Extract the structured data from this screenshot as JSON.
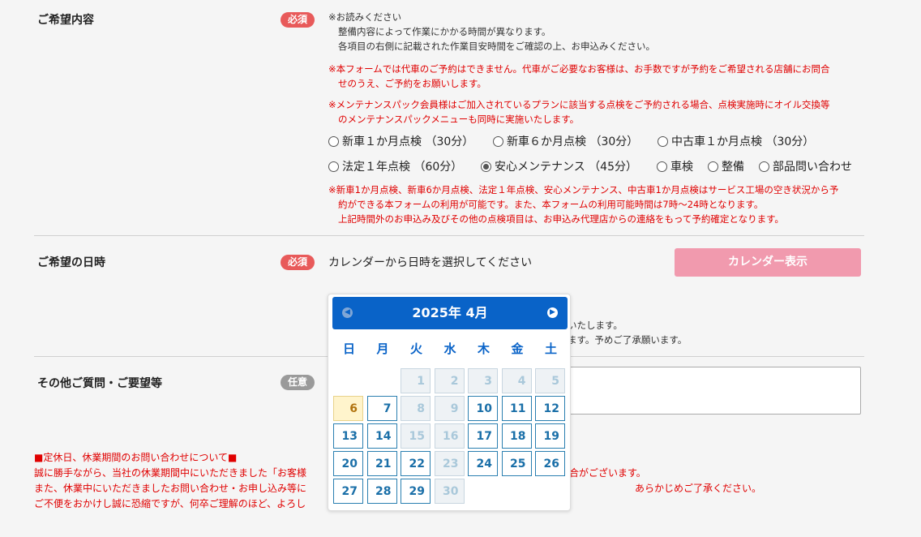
{
  "section1": {
    "label": "ご希望内容",
    "badge": "必須",
    "note_head": "※お読みください",
    "note_l1": "整備内容によって作業にかかる時間が異なります。",
    "note_l2": "各項目の右側に記載された作業目安時間をご確認の上、お申込みください。",
    "red1_l1": "※本フォームでは代車のご予約はできません。代車がご必要なお客様は、お手数ですが予約をご希望される店舗にお問合",
    "red1_l2": "せのうえ、ご予約をお願いします。",
    "red2_l1": "※メンテナンスパック会員様はご加入されているプランに該当する点検をご予約される場合、点検実施時にオイル交換等",
    "red2_l2": "のメンテナンスパックメニューも同時に実施いたします。",
    "options": [
      "新車１か月点検 （30分）",
      "新車６か月点検 （30分）",
      "中古車１か月点検 （30分）",
      "法定１年点検 （60分）",
      "安心メンテナンス （45分）",
      "車検",
      "整備",
      "部品問い合わせ"
    ],
    "red3_l1": "※新車1か月点検、新車6か月点検、法定１年点検、安心メンテナンス、中古車1か月点検はサービス工場の空き状況から予",
    "red3_l2": "約ができる本フォームの利用が可能です。また、本フォームの利用可能時間は7時〜24時となります。",
    "red3_l3": "上記時間外のお申込み及びその他の点検項目は、お申込み代理店からの連絡をもって予約確定となります。"
  },
  "section2": {
    "label": "ご希望の日時",
    "badge": "必須",
    "prompt": "カレンダーから日時を選択してください",
    "button": "カレンダー表示",
    "hidden_l1": "いたします。",
    "hidden_l2": "ます。予めご了承願います。"
  },
  "section3": {
    "label": "その他ご質問・ご要望等",
    "badge": "任意"
  },
  "calendar": {
    "title": "2025年 4月",
    "weekdays": [
      "日",
      "月",
      "火",
      "水",
      "木",
      "金",
      "土"
    ],
    "days": [
      {
        "d": "1",
        "s": "off"
      },
      {
        "d": "2",
        "s": "off"
      },
      {
        "d": "3",
        "s": "off"
      },
      {
        "d": "4",
        "s": "off"
      },
      {
        "d": "5",
        "s": "off"
      },
      {
        "d": "6",
        "s": "today"
      },
      {
        "d": "7",
        "s": "on"
      },
      {
        "d": "8",
        "s": "off"
      },
      {
        "d": "9",
        "s": "off"
      },
      {
        "d": "10",
        "s": "on"
      },
      {
        "d": "11",
        "s": "on"
      },
      {
        "d": "12",
        "s": "on"
      },
      {
        "d": "13",
        "s": "on"
      },
      {
        "d": "14",
        "s": "on"
      },
      {
        "d": "15",
        "s": "off"
      },
      {
        "d": "16",
        "s": "off"
      },
      {
        "d": "17",
        "s": "on"
      },
      {
        "d": "18",
        "s": "on"
      },
      {
        "d": "19",
        "s": "on"
      },
      {
        "d": "20",
        "s": "on"
      },
      {
        "d": "21",
        "s": "on"
      },
      {
        "d": "22",
        "s": "on"
      },
      {
        "d": "23",
        "s": "off"
      },
      {
        "d": "24",
        "s": "on"
      },
      {
        "d": "25",
        "s": "on"
      },
      {
        "d": "26",
        "s": "on"
      },
      {
        "d": "27",
        "s": "on"
      },
      {
        "d": "28",
        "s": "on"
      },
      {
        "d": "29",
        "s": "on"
      },
      {
        "d": "30",
        "s": "off"
      }
    ]
  },
  "footer": {
    "heading": "■定休日、休業期間のお問い合わせについて■",
    "l1_left": "誠に勝手ながら、当社の休業期間中にいただきました「お客様",
    "l1_right": "合がございます。",
    "l2_left": "また、休業中にいただきましたお問い合わせ・お申し込み等に",
    "l2_right": "あらかじめご了承ください。",
    "l3_left": "ご不便をおかけし誠に恐縮ですが、何卒ご理解のほど、よろし"
  }
}
